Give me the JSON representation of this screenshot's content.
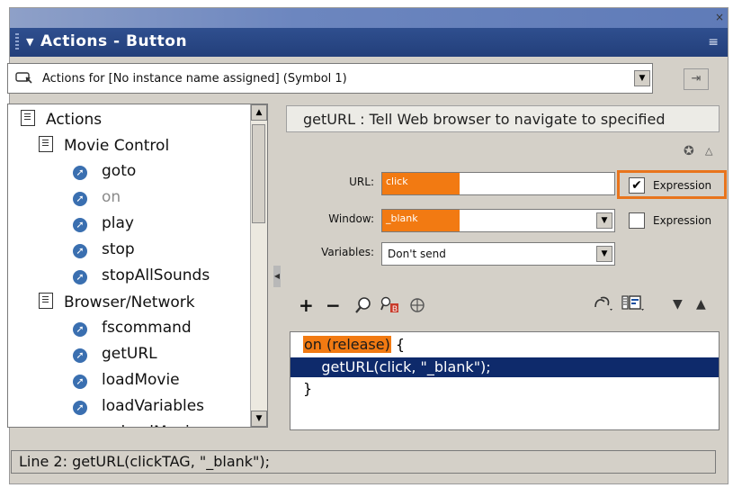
{
  "window": {
    "close_glyph": "×",
    "title": "Actions - Button",
    "menu_glyph": "≡"
  },
  "target": {
    "icon": "button-symbol-icon",
    "text": "Actions for [No instance name assigned]  (Symbol 1)"
  },
  "toolbox": {
    "items": [
      {
        "label": "Actions",
        "type": "book"
      },
      {
        "label": "Movie Control",
        "type": "book"
      },
      {
        "label": "goto",
        "type": "action"
      },
      {
        "label": "on",
        "type": "action"
      },
      {
        "label": "play",
        "type": "action"
      },
      {
        "label": "stop",
        "type": "action"
      },
      {
        "label": "stopAllSounds",
        "type": "action"
      },
      {
        "label": "Browser/Network",
        "type": "book"
      },
      {
        "label": "fscommand",
        "type": "action"
      },
      {
        "label": "getURL",
        "type": "action"
      },
      {
        "label": "loadMovie",
        "type": "action"
      },
      {
        "label": "loadVariables",
        "type": "action"
      },
      {
        "label": "unloadMovie",
        "type": "action"
      }
    ]
  },
  "params": {
    "description": "getURL : Tell Web browser to navigate to specified",
    "url_label": "URL:",
    "url_value": "click",
    "window_label": "Window:",
    "window_value": "_blank",
    "variables_label": "Variables:",
    "variables_value": "Don't send",
    "expression_label": "Expression",
    "url_expression_checked": true,
    "window_expression_checked": false
  },
  "toolbar": {
    "add": "+",
    "remove": "−"
  },
  "code": {
    "line1_keyword": "on (release)",
    "line1_rest": " {",
    "line2": "    getURL(click, \"_blank\");",
    "line3": "}"
  },
  "status": {
    "text": "Line 2: getURL(clickTAG, \"_blank\");"
  },
  "colors": {
    "highlight": "#f27a12",
    "selection": "#0e2a6b",
    "title_bar": "#2f4f8f"
  }
}
